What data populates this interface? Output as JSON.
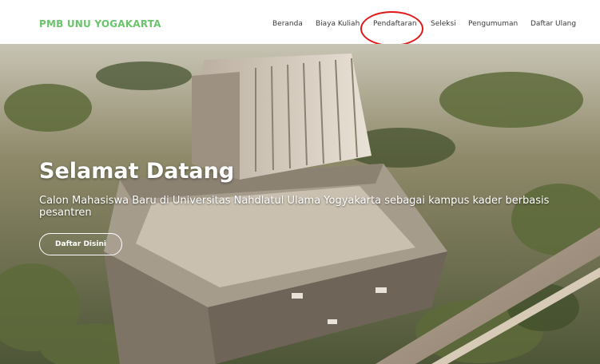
{
  "header": {
    "brand": "PMB UNU YOGAKARTA",
    "nav": [
      {
        "label": "Beranda"
      },
      {
        "label": "Biaya Kuliah"
      },
      {
        "label": "Pendaftaran"
      },
      {
        "label": "Seleksi"
      },
      {
        "label": "Pengumuman"
      },
      {
        "label": "Daftar Ulang"
      }
    ]
  },
  "hero": {
    "title": "Selamat Datang",
    "subtitle": "Calon Mahasiswa Baru di Universitas Nahdlatul Ulama Yogyakarta sebagai kampus kader berbasis pesantren",
    "cta_label": "Daftar Disini"
  },
  "colors": {
    "brand": "#6ac46c",
    "highlight": "#e01818"
  }
}
